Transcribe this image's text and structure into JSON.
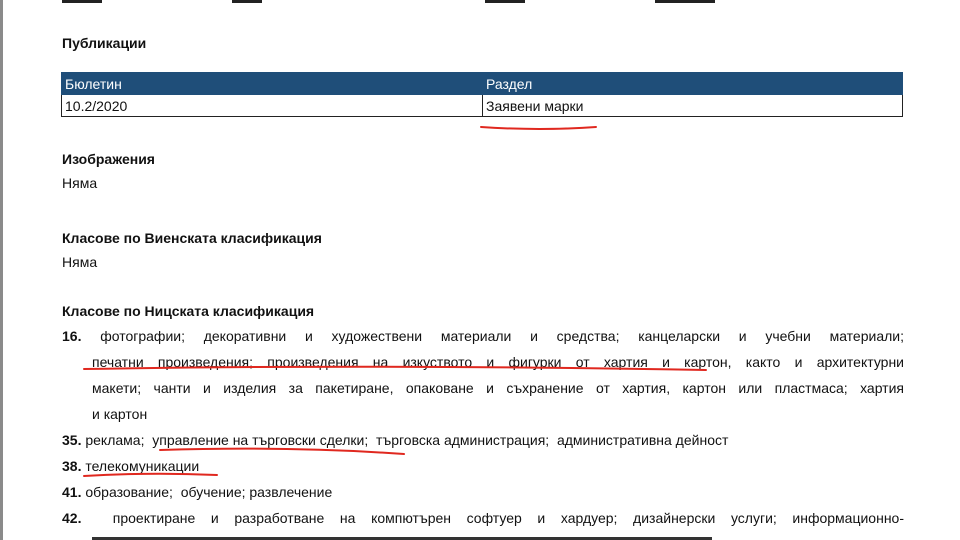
{
  "publications": {
    "heading": "Публикации",
    "table": {
      "headers": [
        "Бюлетин",
        "Раздел"
      ],
      "rows": [
        [
          "10.2/2020",
          "Заявени марки"
        ]
      ]
    }
  },
  "images": {
    "heading": "Изображения",
    "value": "Няма"
  },
  "vienna": {
    "heading": "Класове по Виенската класификация",
    "value": "Няма"
  },
  "nice": {
    "heading": "Класове по Ницската класификация",
    "classes": [
      {
        "num": "16.",
        "lines": [
          "фотографии; декоративни и художествени материали и средства; канцеларски и учебни материали;",
          "печатни произведения; произведения на изкуството и фигурки от хартия и картон, както и архитектурни",
          "макети; чанти и изделия за пакетиране, опаковане и съхранение от хартия, картон или пластмаса; хартия",
          "и картон"
        ]
      },
      {
        "num": "35.",
        "text": "реклама;  управление на търговски сделки;  търговска администрация;  административна дейност"
      },
      {
        "num": "38.",
        "text": "телекомуникации"
      },
      {
        "num": "41.",
        "text": "образование;  обучение; развлечение"
      },
      {
        "num": "42.",
        "text": "проектиране и разработване на компютърен софтуер и хардуер; дизайнерски услуги; информационно-"
      }
    ]
  },
  "annotation_color": "#e0281f",
  "header_color": "#1f4e79"
}
